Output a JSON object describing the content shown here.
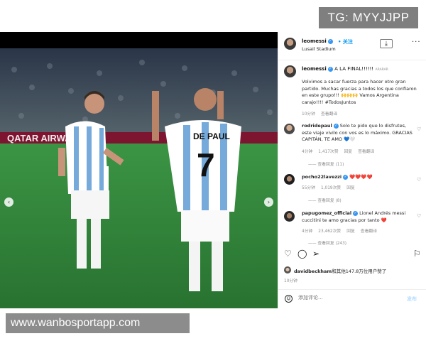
{
  "watermarks": {
    "top": "TG: MYYJJPP",
    "bottom": "www.wanbosportapp.com"
  },
  "post": {
    "author": "leomessi",
    "follow_label": "关注",
    "location": "Lusail Stadium",
    "caption_author": "leomessi",
    "caption_title": "A LA FINAL!!!!!!",
    "caption_title_translate": "ARARAR",
    "caption_body": "Volvimos a sacar fuerza para hacer otro gran partido. Muchas gracias a todos los que confiaron en este grupo!!! 🙌🙌🙌 Vamos Argentina carajo!!!! #TodosJuntos",
    "caption_time": "10分钟",
    "caption_translate": "查看翻译",
    "photo_jersey_name": "DE PAUL",
    "photo_jersey_number": "7",
    "photo_banner": "QATAR AIRWAYS"
  },
  "comments": [
    {
      "user": "rodridepaul",
      "verified": true,
      "text": "Solo te pido que lo disfrutes, este viaje vivilo con vos es lo máximo. GRACIAS CAPITÁN, TE AMO 💙🤍",
      "time": "4分钟",
      "likes": "1,417次赞",
      "reply": "回复",
      "translate": "查看翻译",
      "replies": "—— 查看回复 (11)"
    },
    {
      "user": "pocho22lavezzi",
      "verified": true,
      "text": "❤️❤️❤️❤️",
      "time": "55分钟",
      "likes": "1,019次赞",
      "reply": "回复",
      "translate": "",
      "replies": "—— 查看回复 (8)"
    },
    {
      "user": "papugomez_official",
      "verified": true,
      "text": "Lionel Andrés messi cuccitini te amo gracias por tanto ❤️",
      "time": "4分钟",
      "likes": "23,462次赞",
      "reply": "回复",
      "translate": "查看翻译",
      "replies": "—— 查看回复 (243)"
    }
  ],
  "engagement": {
    "liked_by_user": "davidbeckham",
    "liked_by_rest": "和其他147.8万位用户赞了",
    "time": "10分钟"
  },
  "comment_box": {
    "placeholder": "添加评论...",
    "post_label": "发布"
  },
  "icons": {
    "heart": "heart-icon",
    "comment": "comment-icon",
    "share": "send-icon",
    "save": "bookmark-icon",
    "download": "download-icon",
    "more": "more-icon",
    "emoji": "emoji-icon",
    "prev": "chevron-left-icon",
    "next": "chevron-right-icon"
  },
  "carousel": {
    "count": 10,
    "active_index": 5
  },
  "colors": {
    "accent": "#0095f6",
    "verified": "#3897f0",
    "heart": "#ed4956",
    "pitch": "#2f8a3a",
    "argentina_blue": "#75aadb"
  }
}
